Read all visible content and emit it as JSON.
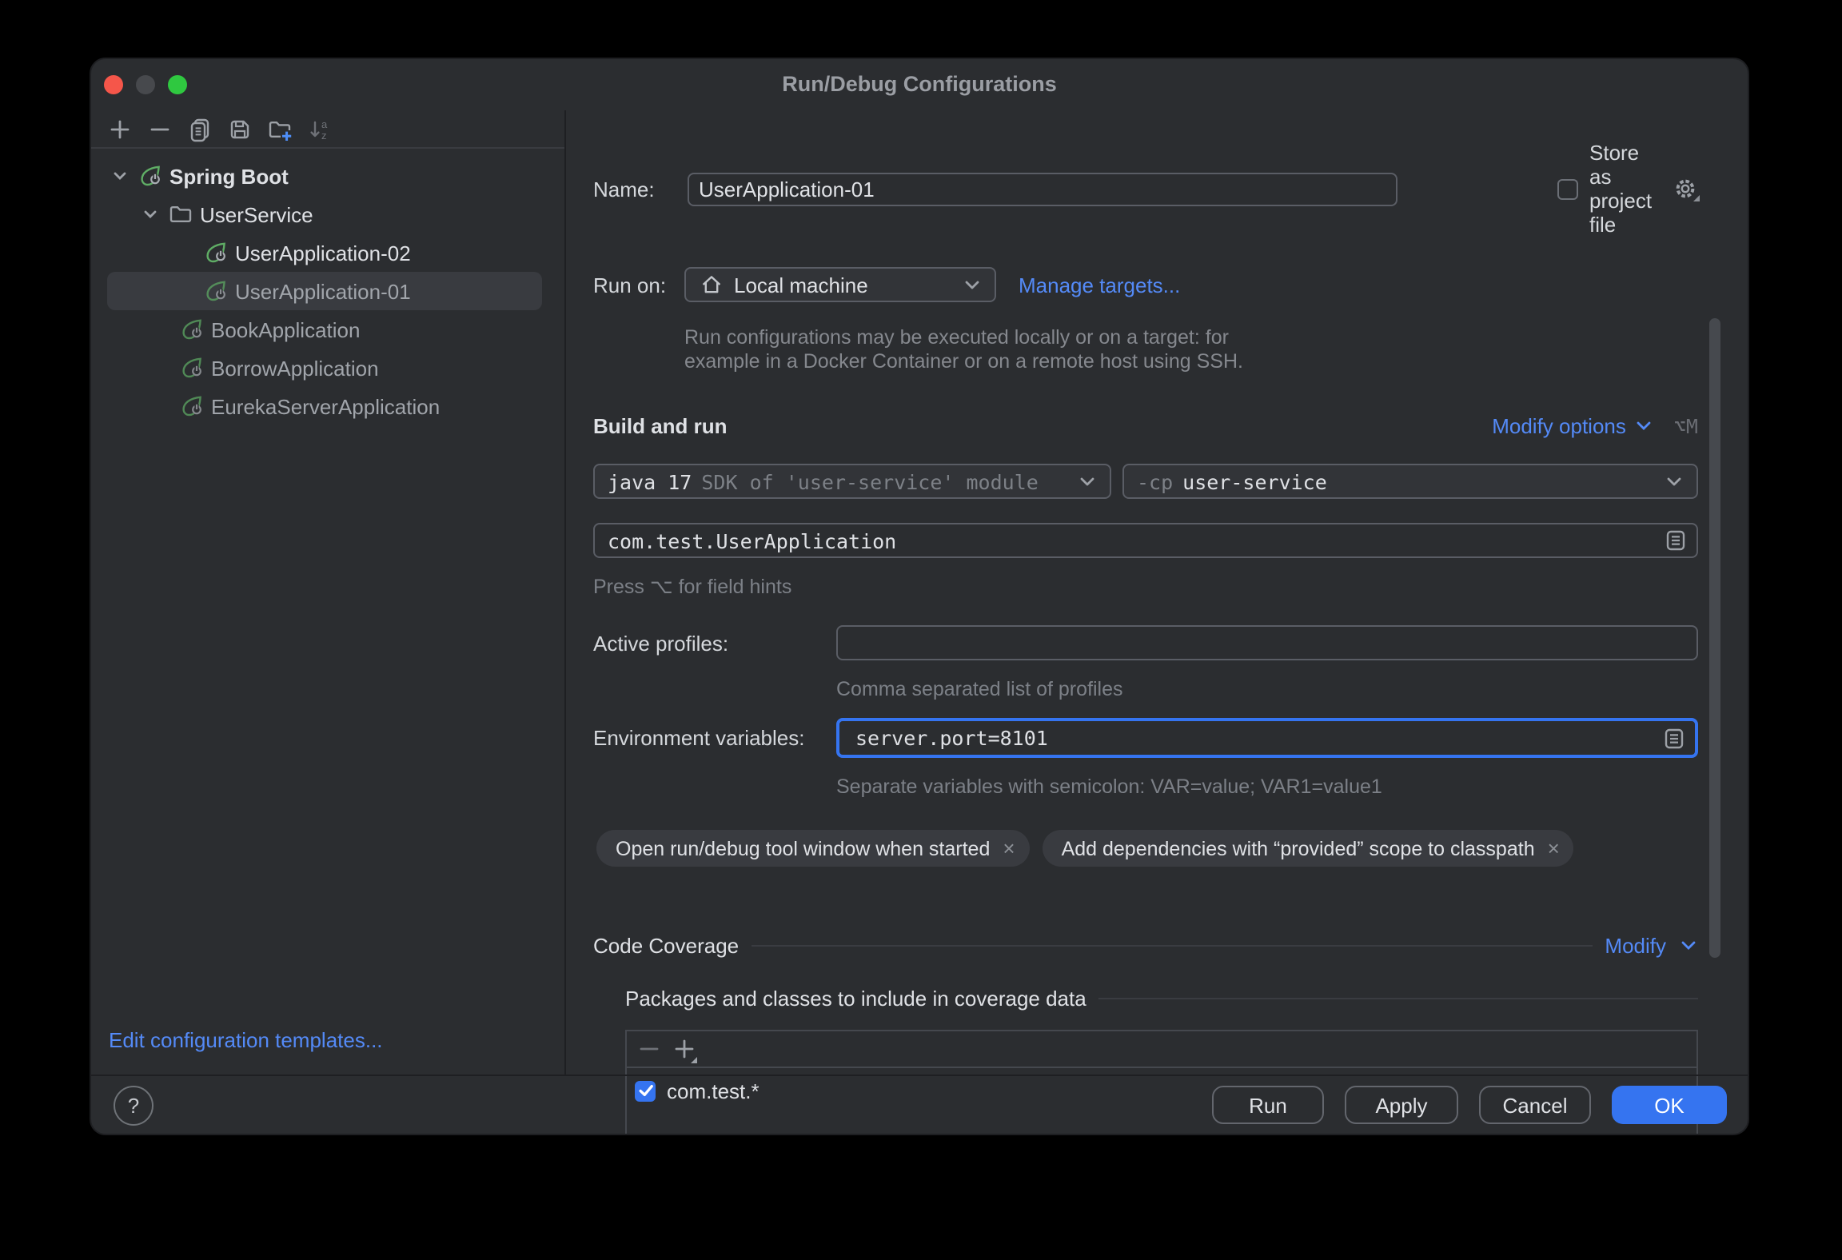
{
  "window": {
    "title": "Run/Debug Configurations"
  },
  "colors": {
    "accent": "#3574F0",
    "link": "#548AF7",
    "spring_green": "#5FAD65",
    "selection": "#393B40"
  },
  "sidebar": {
    "toolbar_icons": [
      "add-icon",
      "remove-icon",
      "copy-icon",
      "save-icon",
      "new-folder-icon",
      "sort-alphabetically-icon"
    ],
    "tree": [
      {
        "label": "Spring Boot",
        "icon": "spring-boot-icon",
        "expanded": true
      },
      {
        "label": "UserService",
        "icon": "folder-icon",
        "expanded": true
      },
      {
        "label": "UserApplication-02",
        "icon": "spring-boot-icon"
      },
      {
        "label": "UserApplication-01",
        "icon": "spring-boot-icon",
        "selected": true
      },
      {
        "label": "BookApplication",
        "icon": "spring-boot-icon"
      },
      {
        "label": "BorrowApplication",
        "icon": "spring-boot-icon"
      },
      {
        "label": "EurekaServerApplication",
        "icon": "spring-boot-icon"
      }
    ],
    "edit_templates_link": "Edit configuration templates..."
  },
  "form": {
    "name_label": "Name:",
    "name_value": "UserApplication-01",
    "store_as_project_file_label": "Store as project file",
    "run_on_label": "Run on:",
    "run_on_value": "Local machine",
    "manage_targets_link": "Manage targets...",
    "run_on_hint_line1": "Run configurations may be executed locally or on a target: for",
    "run_on_hint_line2": "example in a Docker Container or on a remote host using SSH.",
    "build_and_run": {
      "title": "Build and run",
      "modify_options_link": "Modify options",
      "shortcut": "⌥M",
      "jdk_value": "java 17",
      "jdk_hint": "SDK of 'user-service' module",
      "cp_prefix": "-cp",
      "cp_value": "user-service",
      "main_class": "com.test.UserApplication",
      "field_hint": "Press ⌥ for field hints"
    },
    "active_profiles_label": "Active profiles:",
    "active_profiles_value": "",
    "active_profiles_hint": "Comma separated list of profiles",
    "env_label": "Environment variables:",
    "env_value": "server.port=8101",
    "env_hint": "Separate variables with semicolon: VAR=value; VAR1=value1",
    "chips": [
      "Open run/debug tool window when started",
      "Add dependencies with “provided” scope to classpath"
    ],
    "chip_close": "×",
    "code_coverage": {
      "title": "Code Coverage",
      "modify_link": "Modify",
      "packages_label": "Packages and classes to include in coverage data",
      "rows": [
        {
          "label": "com.test.*",
          "checked": true
        }
      ]
    }
  },
  "footer": {
    "help": "?",
    "run_label": "Run",
    "apply_label": "Apply",
    "cancel_label": "Cancel",
    "ok_label": "OK"
  }
}
